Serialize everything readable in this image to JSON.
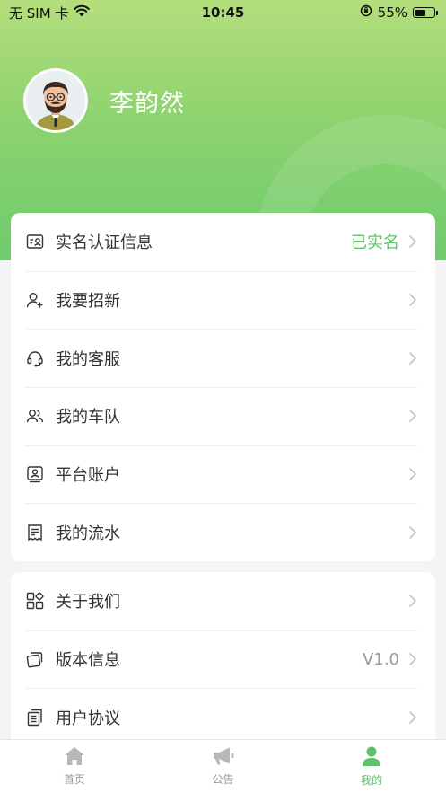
{
  "status_bar": {
    "carrier": "无 SIM 卡",
    "time": "10:45",
    "battery": "55%",
    "battery_level": 0.55
  },
  "profile": {
    "name": "李韵然"
  },
  "menu_group_1": [
    {
      "label": "实名认证信息",
      "value": "已实名",
      "icon": "id-card-icon",
      "value_color": "#5cc36a"
    },
    {
      "label": "我要招新",
      "value": "",
      "icon": "add-user-icon"
    },
    {
      "label": "我的客服",
      "value": "",
      "icon": "headset-icon"
    },
    {
      "label": "我的车队",
      "value": "",
      "icon": "team-icon"
    },
    {
      "label": "平台账户",
      "value": "",
      "icon": "account-icon"
    },
    {
      "label": "我的流水",
      "value": "",
      "icon": "receipt-icon"
    }
  ],
  "menu_group_2": [
    {
      "label": "关于我们",
      "value": "",
      "icon": "apps-icon"
    },
    {
      "label": "版本信息",
      "value": "V1.0",
      "icon": "layers-icon"
    },
    {
      "label": "用户协议",
      "value": "",
      "icon": "document-icon"
    }
  ],
  "tabbar": [
    {
      "label": "首页",
      "icon": "home-icon",
      "active": false
    },
    {
      "label": "公告",
      "icon": "megaphone-icon",
      "active": false
    },
    {
      "label": "我的",
      "icon": "profile-icon",
      "active": true
    }
  ],
  "colors": {
    "accent": "#5cc36a",
    "hero_top": "#b4de7c",
    "hero_bottom": "#6ecb6e"
  }
}
